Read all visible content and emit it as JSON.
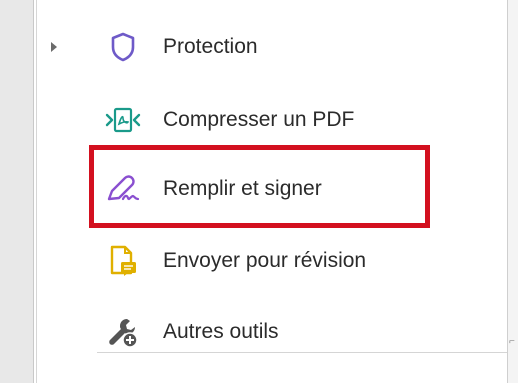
{
  "tools": [
    {
      "label": "Protection",
      "icon": "shield-icon"
    },
    {
      "label": "Compresser un PDF",
      "icon": "compress-pdf-icon"
    },
    {
      "label": "Remplir et signer",
      "icon": "fill-sign-pen-icon"
    },
    {
      "label": "Envoyer pour révision",
      "icon": "send-for-review-icon"
    },
    {
      "label": "Autres outils",
      "icon": "more-tools-wrench-icon"
    }
  ],
  "highlighted_tool": "Remplir et signer",
  "colors": {
    "highlight": "#d3101f",
    "protection_icon": "#6e5ac8",
    "compress_icon": "#1a9a8a",
    "fill_sign_icon": "#8a4fd0",
    "review_icon": "#e0b000",
    "other_icon": "#555555"
  }
}
